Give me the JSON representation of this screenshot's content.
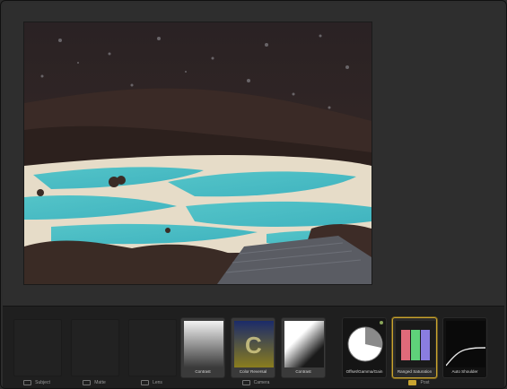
{
  "groups": {
    "subject": {
      "label": "Subject"
    },
    "matte": {
      "label": "Matte"
    },
    "lens": {
      "label": "Lens"
    },
    "camera": {
      "label": "Camera"
    },
    "post": {
      "label": "Post"
    }
  },
  "camera_filters": [
    {
      "name": "Contrast",
      "icon": "gradient-contrast-thumbnail"
    },
    {
      "name": "Color Reversal",
      "icon": "color-reversal-thumbnail"
    },
    {
      "name": "Contrast",
      "icon": "diagonal-contrast-thumbnail"
    }
  ],
  "post_filters": [
    {
      "name": "Offset/Gamma/Gain",
      "icon": "color-wheel-thumbnail"
    },
    {
      "name": "Ranged Saturation",
      "icon": "rgb-bars-thumbnail",
      "selected": true
    },
    {
      "name": "Auto Shoulder",
      "icon": "curve-thumbnail"
    }
  ],
  "colors": {
    "accent": "#c9a431",
    "panel": "#1f1f1f",
    "background": "#2d2d2d"
  }
}
